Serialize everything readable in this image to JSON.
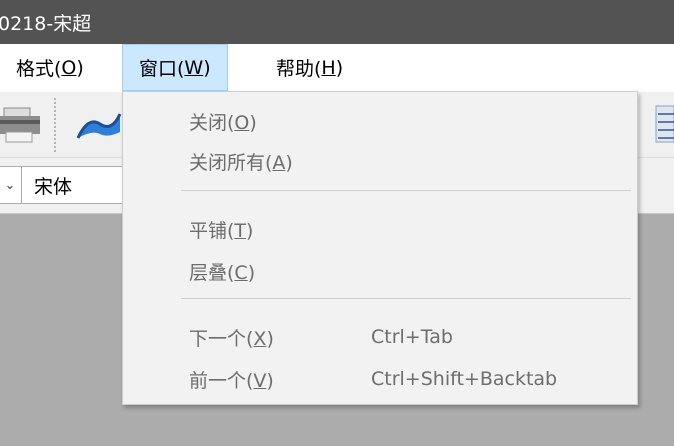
{
  "window": {
    "title": "0218-宋超"
  },
  "menubar": {
    "format": {
      "pre": "格式(",
      "key": "O",
      "post": ")"
    },
    "window": {
      "pre": "窗口(",
      "key": "W",
      "post": ")"
    },
    "help": {
      "pre": "帮助(",
      "key": "H",
      "post": ")"
    }
  },
  "fontbar": {
    "font_name": "宋体"
  },
  "window_menu": {
    "close": {
      "pre": "关闭(",
      "key": "O",
      "post": ")"
    },
    "close_all": {
      "pre": "关闭所有(",
      "key": "A",
      "post": ")"
    },
    "tile": {
      "pre": "平铺(",
      "key": "T",
      "post": ")"
    },
    "cascade": {
      "pre": "层叠(",
      "key": "C",
      "post": ")"
    },
    "next": {
      "pre": "下一个(",
      "key": "X",
      "post": ")",
      "shortcut": "Ctrl+Tab"
    },
    "previous": {
      "pre": "前一个(",
      "key": "V",
      "post": ")",
      "shortcut": "Ctrl+Shift+Backtab"
    }
  },
  "colors": {
    "titlebar_bg": "#535353",
    "menu_active_bg": "#cce8ff",
    "menu_disabled_text": "#6d6d6d",
    "workspace_bg": "#acacac"
  },
  "icons": [
    "printer-icon",
    "chart-icon",
    "list-icon",
    "chevron-down-icon"
  ]
}
